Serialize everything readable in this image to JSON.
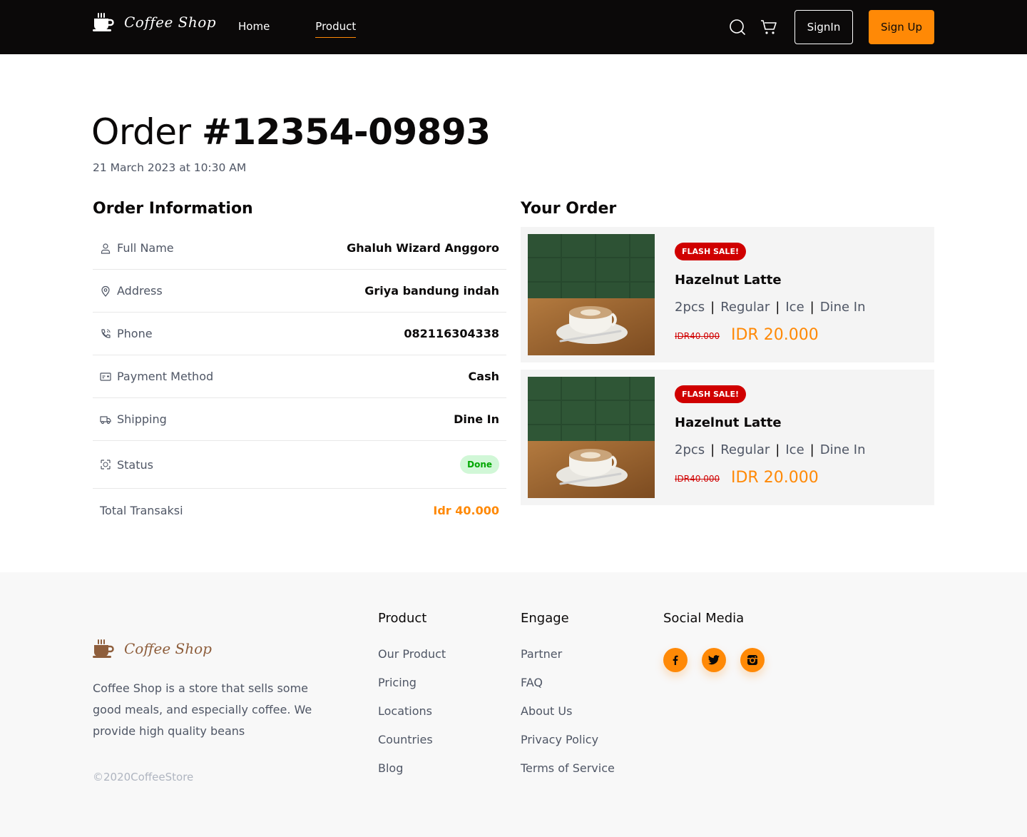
{
  "nav": {
    "brand": "Coffee Shop",
    "links": [
      {
        "label": "Home"
      },
      {
        "label": "Product"
      }
    ],
    "signin_label": "SignIn",
    "signup_label": "Sign Up"
  },
  "order": {
    "title_prefix": "Order ",
    "number": "#12354-09893",
    "date": "21 March 2023 at 10:30 AM"
  },
  "info": {
    "title": "Order Information",
    "rows": [
      {
        "label": "Full Name",
        "value": "Ghaluh Wizard Anggoro",
        "icon": "user-icon"
      },
      {
        "label": "Address",
        "value": "Griya bandung indah",
        "icon": "location-pin-icon"
      },
      {
        "label": "Phone",
        "value": "082116304338",
        "icon": "phone-icon"
      },
      {
        "label": "Payment Method",
        "value": "Cash",
        "icon": "card-icon"
      },
      {
        "label": "Shipping",
        "value": "Dine In",
        "icon": "truck-icon"
      },
      {
        "label": "Status",
        "value": "Done",
        "icon": "status-icon"
      }
    ],
    "total_label": "Total Transaksi",
    "total_value": "Idr 40.000"
  },
  "your_order": {
    "title": "Your Order",
    "items": [
      {
        "badge": "FLASH SALE!",
        "name": "Hazelnut Latte",
        "qty": "2pcs",
        "size": "Regular",
        "temp": "Ice",
        "method": "Dine In",
        "price_old": "IDR40.000",
        "price_new": "IDR 20.000"
      },
      {
        "badge": "FLASH SALE!",
        "name": "Hazelnut Latte",
        "qty": "2pcs",
        "size": "Regular",
        "temp": "Ice",
        "method": "Dine In",
        "price_old": "IDR40.000",
        "price_new": "IDR 20.000"
      }
    ]
  },
  "footer": {
    "brand": "Coffee Shop",
    "description": "Coffee Shop is a store that sells some good meals, and especially coffee. We provide high quality beans",
    "copyright": "©2020CoffeeStore",
    "product": {
      "title": "Product",
      "links": [
        "Our Product",
        "Pricing",
        "Locations",
        "Countries",
        "Blog"
      ]
    },
    "engage": {
      "title": "Engage",
      "links": [
        "Partner",
        "FAQ",
        "About Us",
        "Privacy Policy",
        "Terms of Service"
      ]
    },
    "social": {
      "title": "Social Media",
      "icons": [
        "facebook-icon",
        "twitter-icon",
        "instagram-icon"
      ]
    }
  },
  "colors": {
    "accent": "#ff8906",
    "nav_bg": "#0b0909",
    "flash_badge": "#d00000",
    "done_badge_bg": "#d1f7d7",
    "done_badge_text": "#00a700",
    "brown": "#8e5e3c"
  }
}
